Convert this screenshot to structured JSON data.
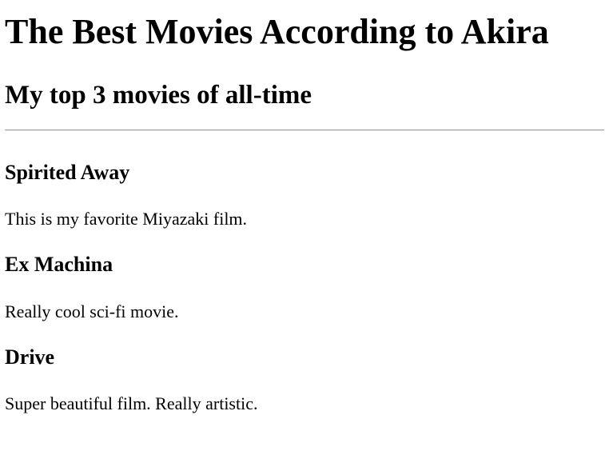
{
  "page": {
    "title": "The Best Movies According to Akira",
    "subtitle": "My top 3 movies of all-time"
  },
  "movies": [
    {
      "title": "Spirited Away",
      "description": "This is my favorite Miyazaki film."
    },
    {
      "title": "Ex Machina",
      "description": "Really cool sci-fi movie."
    },
    {
      "title": "Drive",
      "description": "Super beautiful film. Really artistic."
    }
  ]
}
